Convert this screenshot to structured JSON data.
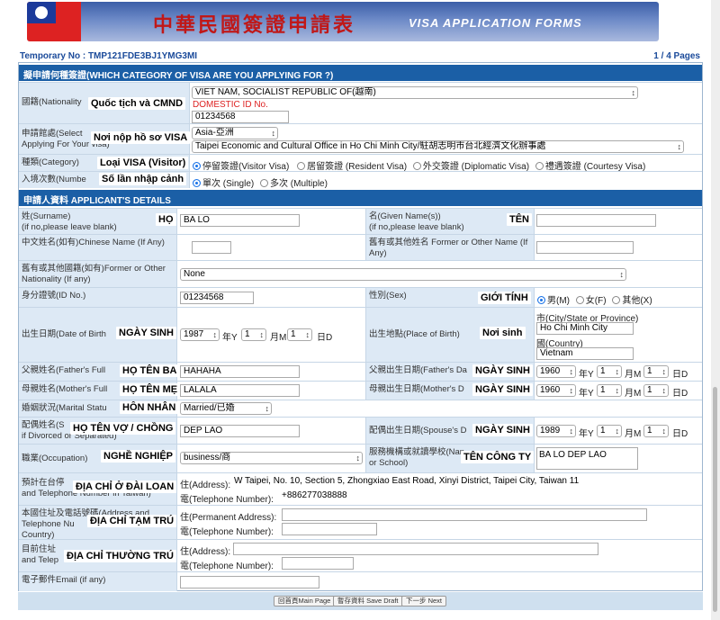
{
  "banner": {
    "title_cn": "中華民國簽證申請表",
    "title_en": "VISA APPLICATION FORMS"
  },
  "header": {
    "temporary_no": "Temporary No : TMP121FDE3BJ1YMG3MI",
    "pages": "1 / 4 Pages"
  },
  "section1": {
    "title": "擬申請何種簽證(WHICH CATEGORY OF VISA ARE YOU APPLYING FOR ?)"
  },
  "nationality": {
    "label": "國籍(Nationality",
    "overlay": "Quốc tịch và CMND",
    "value": "VIET NAM, SOCIALIST REPUBLIC OF(越南)",
    "id_label": "DOMESTIC ID No.",
    "id_value": "01234568"
  },
  "place": {
    "label": "申請館處(Select\nApplying For Your visa)",
    "overlay": "Nơi nộp hồ sơ VISA",
    "region": "Asia-亞洲",
    "office": "Taipei Economic and Cultural Office in Ho Chi Minh City/駐胡志明市台北經濟文化辦事處"
  },
  "category": {
    "label": "種類(Category)",
    "overlay": "Loại VISA (Visitor)",
    "options": [
      "停留簽證(Visitor Visa)",
      "居留簽證 (Resident Visa)",
      "外交簽證 (Diplomatic Visa)",
      "禮遇簽證 (Courtesy Visa)"
    ],
    "selected": 0
  },
  "entries": {
    "label": "入境次數(Numbe",
    "overlay": "Số lần nhập cảnh",
    "options": [
      "單次 (Single)",
      "多次 (Multiple)"
    ],
    "selected": 0
  },
  "section2": {
    "title": "申請人資料 APPLICANT'S DETAILS"
  },
  "surname": {
    "label": "姓(Surname)\n(if no,please leave blank)",
    "overlay": "HỌ",
    "value": "BA LO"
  },
  "given": {
    "label": "名(Given Name(s))\n(if no,please leave blank)",
    "overlay": "TÊN",
    "value": ""
  },
  "chinese_name": {
    "label": "中文姓名(如有)Chinese Name (If Any)",
    "value": ""
  },
  "former_name": {
    "label": "舊有或其他姓名 Former or Other Name (If Any)",
    "value": ""
  },
  "former_nationality": {
    "label": "舊有或其他國籍(如有)Former or Other Nationality (If any)",
    "value": "None"
  },
  "id_no": {
    "label": "身分證號(ID No.)",
    "value": "01234568"
  },
  "sex": {
    "label": "性別(Sex)",
    "overlay": "GIỚI TÍNH",
    "options": [
      "男(M)",
      "女(F)",
      "其他(X)"
    ],
    "selected": 0
  },
  "dob": {
    "label": "出生日期(Date of Birth",
    "overlay": "NGÀY SINH",
    "year": "1987",
    "month": "1",
    "day": "1",
    "u_year": "年Y",
    "u_month": "月M",
    "u_day": "日D"
  },
  "pob": {
    "label": "出生地點(Place of Birth)",
    "overlay": "Nơi sinh",
    "city_label": "市(City/State or Province)",
    "city": "Ho Chi Minh City",
    "country_label": "國(Country)",
    "country": "Vietnam"
  },
  "father": {
    "label": "父親姓名(Father's Full",
    "overlay": "HỌ TÊN BA",
    "value": "HAHAHA"
  },
  "father_dob": {
    "label": "父親出生日期(Father's Da",
    "overlay": "NGÀY SINH",
    "year": "1960",
    "month": "1",
    "day": "1"
  },
  "mother": {
    "label": "母親姓名(Mother's Full",
    "overlay": "HỌ TÊN MẸ",
    "value": "LALALA"
  },
  "mother_dob": {
    "label": "母親出生日期(Mother's D",
    "overlay": "NGÀY SINH",
    "year": "1960",
    "month": "1",
    "day": "1"
  },
  "marital": {
    "label": "婚姻狀況(Marital Statu",
    "overlay": "HÔN NHÂN",
    "value": "Married/已婚"
  },
  "spouse": {
    "label": "配偶姓名(S\nif Divorced or Separated)",
    "overlay": "HỌ TÊN VỢ / CHỒNG",
    "value": "DEP LAO"
  },
  "spouse_dob": {
    "label": "配偶出生日期(Spouse's D",
    "overlay": "NGÀY SINH",
    "year": "1989",
    "month": "1",
    "day": "1"
  },
  "occupation": {
    "label": "職業(Occupation)",
    "overlay": "NGHỀ NGHIỆP",
    "value": "business/商"
  },
  "employer": {
    "label": "服務機構或就讀學校(Nan\nor School)",
    "overlay": "TÊN CÔNG TY",
    "value": "BA LO DEP LAO"
  },
  "address_tw": {
    "label": "預計在台停\nand Telephone Number in Taiwan)",
    "overlay": "ĐỊA CHỈ Ở ĐÀI LOAN",
    "addr_label": "住(Address):",
    "addr": "W Taipei, No. 10, Section 5, Zhongxiao East Road, Xinyi District, Taipei City, Taiwan 11",
    "tel_label": "電(Telephone Number):",
    "tel": "+886277038888"
  },
  "address_perm": {
    "label": "本國住址及電話號碼(Address and\nTelephone Nu\nCountry)",
    "overlay": "ĐỊA CHỈ TẠM TRÚ",
    "addr_label": "住(Permanent Address):",
    "addr": "",
    "tel_label": "電(Telephone Number):",
    "tel": ""
  },
  "address_cur": {
    "label": "目前住址\nand Telep",
    "overlay": "ĐỊA CHỈ THƯỜNG TRÚ",
    "addr_label": "住(Address):",
    "addr": "",
    "tel_label": "電(Telephone Number):",
    "tel": ""
  },
  "email": {
    "label": "電子郵件Email (if any)",
    "value": ""
  },
  "footer": {
    "main": "回首頁Main Page",
    "draft": "暫存資料 Save Draft",
    "next": "下一步 Next"
  }
}
